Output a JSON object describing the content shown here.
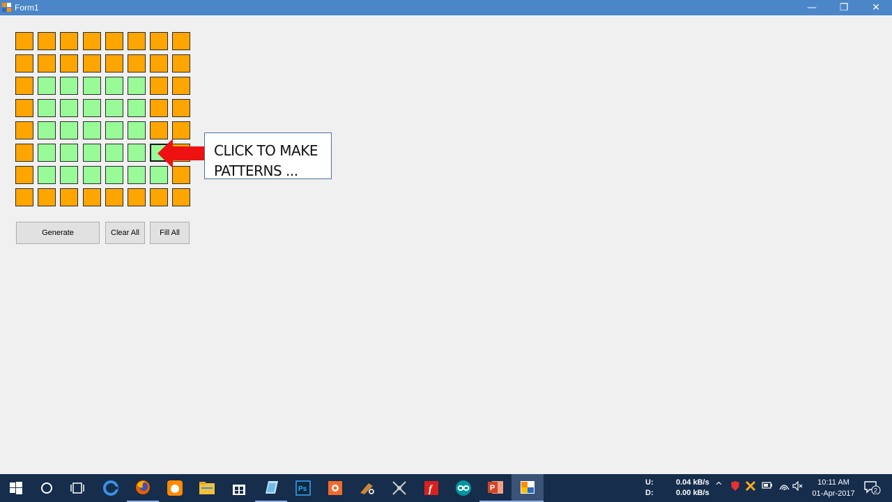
{
  "window": {
    "title": "Form1",
    "minimize": "—",
    "restore": "❐",
    "close": "✕"
  },
  "grid": {
    "rows": [
      [
        "orange",
        "orange",
        "orange",
        "orange",
        "orange",
        "orange",
        "orange",
        "orange"
      ],
      [
        "orange",
        "orange",
        "orange",
        "orange",
        "orange",
        "orange",
        "orange",
        "orange"
      ],
      [
        "orange",
        "green",
        "green",
        "green",
        "green",
        "green",
        "orange",
        "orange"
      ],
      [
        "orange",
        "green",
        "green",
        "green",
        "green",
        "green",
        "orange",
        "orange"
      ],
      [
        "orange",
        "green",
        "green",
        "green",
        "green",
        "green",
        "orange",
        "orange"
      ],
      [
        "orange",
        "green",
        "green",
        "green",
        "green",
        "green",
        "green",
        "orange"
      ],
      [
        "orange",
        "green",
        "green",
        "green",
        "green",
        "green",
        "green",
        "orange"
      ],
      [
        "orange",
        "orange",
        "orange",
        "orange",
        "orange",
        "orange",
        "orange",
        "orange"
      ]
    ],
    "selected": [
      5,
      6
    ],
    "colors": {
      "orange": "#ffa500",
      "green": "#98fb98"
    }
  },
  "buttons": {
    "generate": "Generate",
    "clear_all": "Clear All",
    "fill_all": "Fill All"
  },
  "callout": {
    "line1": "CLICK TO MAKE",
    "line2": "PATTERNS ..."
  },
  "taskbar": {
    "apps": [
      "start-icon",
      "cortana-icon",
      "task-view-icon",
      "edge-icon",
      "firefox-icon",
      "uc-browser-icon",
      "file-explorer-icon",
      "store-icon",
      "notepad-icon",
      "photoshop-icon",
      "app-orange-icon",
      "app-tool-icon",
      "app-network-icon",
      "app-red-f-icon",
      "arduino-icon",
      "powerpoint-icon",
      "form-app-icon"
    ],
    "net_up_label": "U:",
    "net_down_label": "D:",
    "net_up": "0.04 kB/s",
    "net_down": "0.00 kB/s",
    "time": "10:11 AM",
    "date": "01-Apr-2017",
    "notifications": "2"
  }
}
